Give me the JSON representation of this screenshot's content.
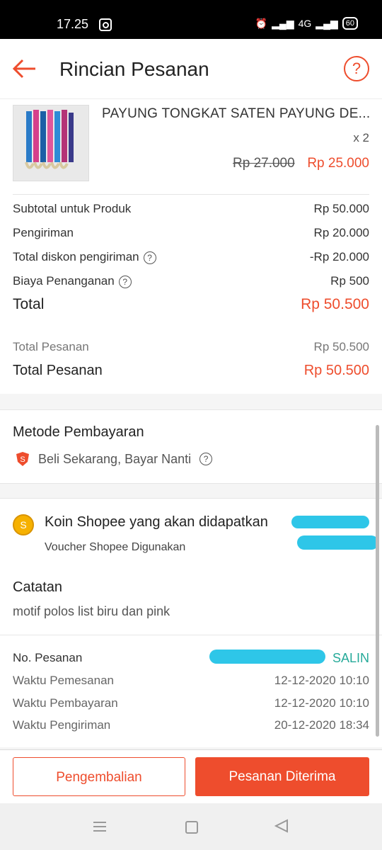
{
  "status_bar": {
    "time": "17.25",
    "network": "4G",
    "battery": "60"
  },
  "header": {
    "title": "Rincian Pesanan",
    "help": "?"
  },
  "product": {
    "name": "PAYUNG TONGKAT SATEN PAYUNG DE...",
    "quantity": "x 2",
    "old_price": "Rp 27.000",
    "new_price": "Rp 25.000"
  },
  "summary": [
    {
      "label": "Subtotal untuk Produk",
      "value": "Rp 50.000",
      "help": false
    },
    {
      "label": "Pengiriman",
      "value": "Rp 20.000",
      "help": false
    },
    {
      "label": "Total diskon pengiriman",
      "value": "-Rp 20.000",
      "help": true
    },
    {
      "label": "Biaya Penanganan",
      "value": "Rp 500",
      "help": true
    }
  ],
  "total": {
    "label": "Total",
    "value": "Rp 50.500"
  },
  "order_total": {
    "small_label": "Total Pesanan",
    "small_value": "Rp 50.500",
    "label": "Total Pesanan",
    "value": "Rp 50.500"
  },
  "payment": {
    "title": "Metode Pembayaran",
    "method": "Beli Sekarang, Bayar Nanti"
  },
  "coins": {
    "title": "Koin Shopee yang akan didapatkan",
    "voucher_label": "Voucher Shopee Digunakan",
    "coin_symbol": "S"
  },
  "notes": {
    "title": "Catatan",
    "text": "motif polos list biru dan pink"
  },
  "order_info": {
    "order_no_label": "No. Pesanan",
    "copy_label": "SALIN",
    "rows": [
      {
        "label": "Waktu Pemesanan",
        "value": "12-12-2020 10:10"
      },
      {
        "label": "Waktu Pembayaran",
        "value": "12-12-2020 10:10"
      },
      {
        "label": "Waktu Pengiriman",
        "value": "20-12-2020 18:34"
      }
    ]
  },
  "actions": {
    "return_label": "Pengembalian",
    "received_label": "Pesanan Diterima"
  },
  "colors": {
    "accent": "#ee4d2d",
    "teal": "#26aa99"
  }
}
